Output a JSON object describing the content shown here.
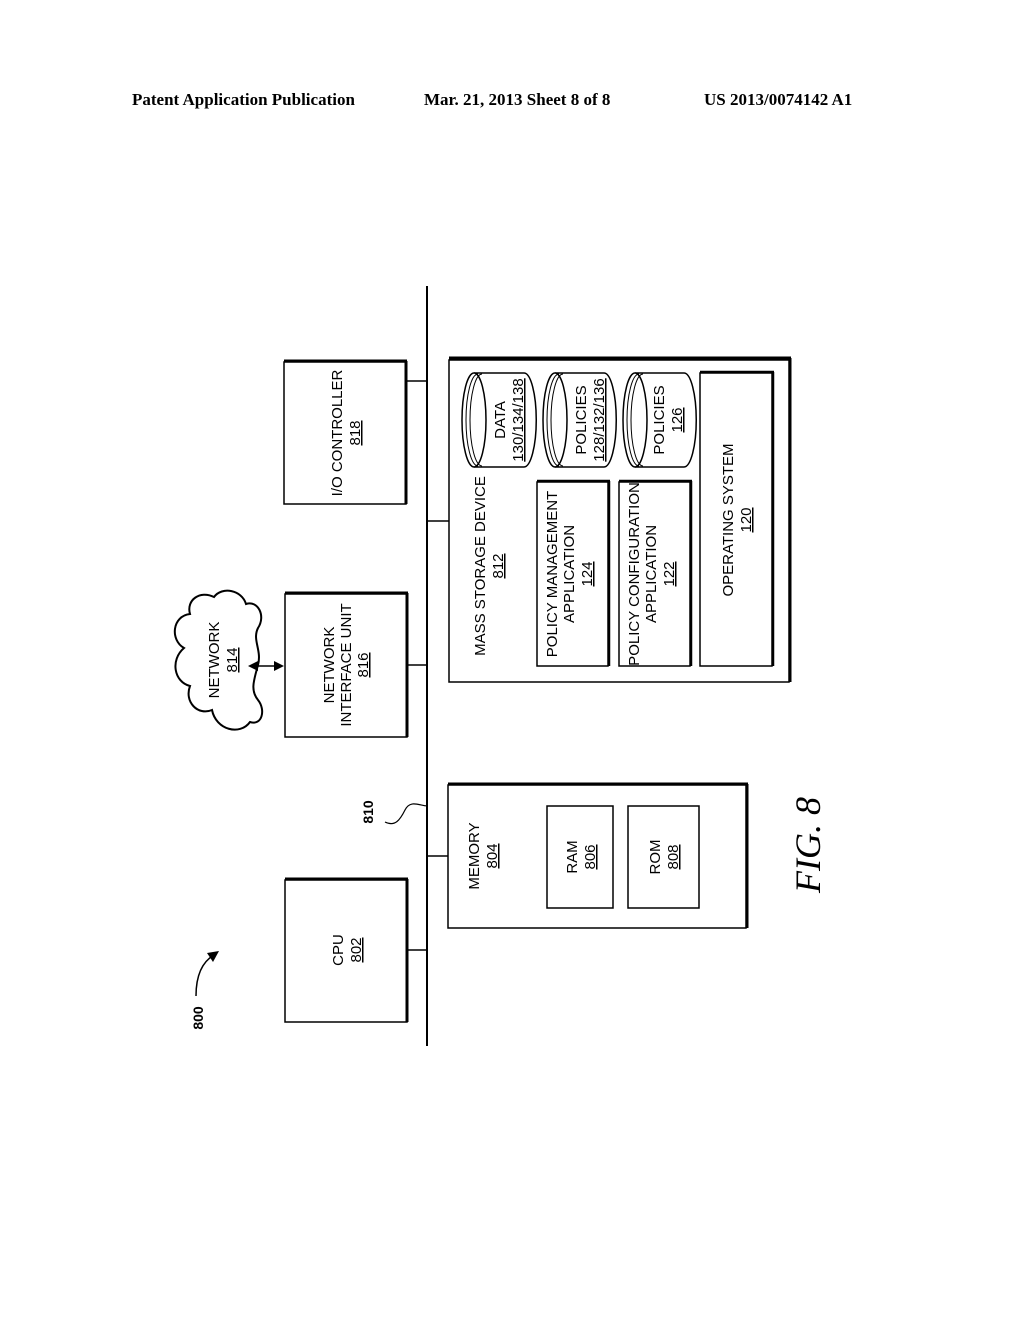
{
  "header": {
    "publication": "Patent Application Publication",
    "date_sheet": "Mar. 21, 2013  Sheet 8 of 8",
    "pub_number": "US 2013/0074142 A1"
  },
  "figure": {
    "label": "FIG. 8",
    "system_ref": "800",
    "bus_ref": "810",
    "cpu": {
      "label": "CPU",
      "ref": "802"
    },
    "memory": {
      "label": "MEMORY",
      "ref": "804"
    },
    "ram": {
      "label": "RAM",
      "ref": "806"
    },
    "rom": {
      "label": "ROM",
      "ref": "808"
    },
    "network": {
      "label": "NETWORK",
      "ref": "814"
    },
    "network_interface": {
      "label_line1": "NETWORK",
      "label_line2": "INTERFACE UNIT",
      "ref": "816"
    },
    "io_controller": {
      "label": "I/O CONTROLLER",
      "ref": "818"
    },
    "mass_storage": {
      "label": "MASS STORAGE DEVICE",
      "ref": "812"
    },
    "policy_management": {
      "label_line1": "POLICY MANAGEMENT",
      "label_line2": "APPLICATION",
      "ref": "124"
    },
    "policy_configuration": {
      "label_line1": "POLICY CONFIGURATION",
      "label_line2": "APPLICATION",
      "ref": "122"
    },
    "operating_system": {
      "label": "OPERATING SYSTEM",
      "ref": "120"
    },
    "db_data": {
      "label": "DATA",
      "ref": "130/134/138"
    },
    "db_policies_a": {
      "label": "POLICIES",
      "ref": "128/132/136"
    },
    "db_policies_b": {
      "label": "POLICIES",
      "ref": "126"
    }
  }
}
